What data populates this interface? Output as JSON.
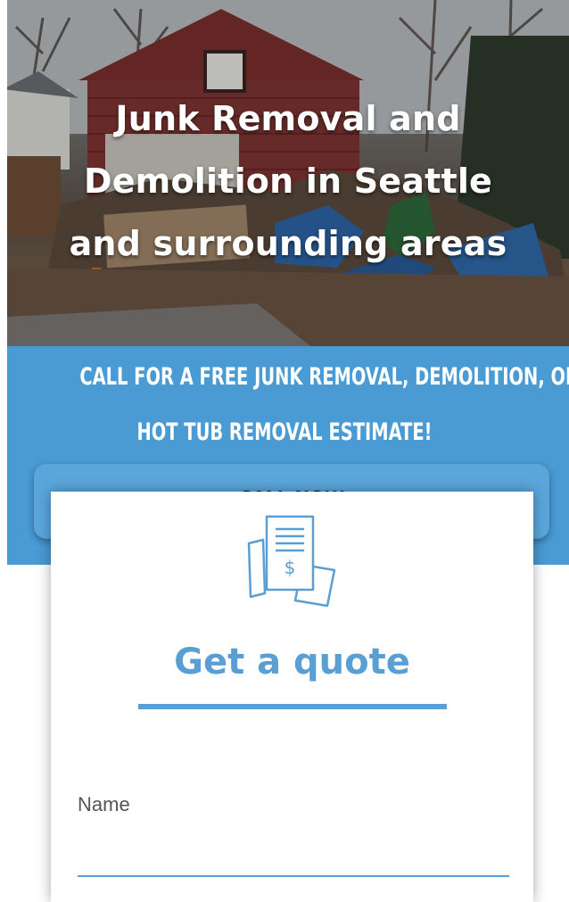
{
  "hero": {
    "title_lines": [
      "Junk Removal and",
      "Demolition in Seattle",
      "and surrounding areas"
    ]
  },
  "band": {
    "headline_lines": [
      "CALL FOR A FREE JUNK REMOVAL, DEMOLITION, OR",
      "HOT TUB REMOVAL ESTIMATE!"
    ],
    "call_button_label": "CALL NOW"
  },
  "quote_form": {
    "title": "Get a quote",
    "name_label": "Name",
    "name_value": ""
  },
  "icons": {
    "quote": "invoice-dollar-icon"
  },
  "colors": {
    "accent_blue": "#4a9ad4",
    "title_blue": "#5a9fd4",
    "hero_text": "#ffffff"
  }
}
